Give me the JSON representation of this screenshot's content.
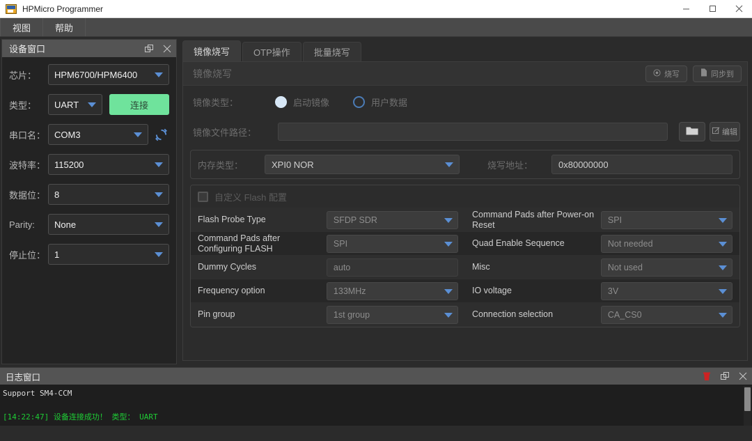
{
  "window": {
    "title": "HPMicro Programmer",
    "icon": "app-icon",
    "minimize": "–",
    "maximize": "□",
    "close": "×"
  },
  "menubar": {
    "items": [
      {
        "label": "视图"
      },
      {
        "label": "帮助"
      }
    ]
  },
  "device_panel": {
    "title": "设备窗口",
    "float_icon": "float-icon",
    "close_icon": "close-icon",
    "fields": {
      "chip_label": "芯片：",
      "chip_value": "HPM6700/HPM6400",
      "type_label": "类型：",
      "type_value": "UART",
      "connect_button": "连接",
      "port_label": "串口名：",
      "port_value": "COM3",
      "refresh_icon": "refresh-icon",
      "baud_label": "波特率：",
      "baud_value": "115200",
      "databits_label": "数据位：",
      "databits_value": "8",
      "parity_label": "Parity:",
      "parity_value": "None",
      "stopbits_label": "停止位：",
      "stopbits_value": "1"
    }
  },
  "main": {
    "tabs": [
      {
        "label": "镜像烧写",
        "active": true
      },
      {
        "label": "OTP操作",
        "active": false
      },
      {
        "label": "批量烧写",
        "active": false
      }
    ],
    "section_title": "镜像烧写",
    "actions": [
      {
        "label": "烧写",
        "icon": "burn-icon"
      },
      {
        "label": "同步到",
        "icon": "sync-icon"
      }
    ],
    "image_type": {
      "label": "镜像类型：",
      "options": [
        {
          "label": "启动镜像",
          "checked": true
        },
        {
          "label": "用户数据",
          "checked": false
        }
      ]
    },
    "file_path": {
      "label": "镜像文件路径：",
      "value": "",
      "placeholder": "",
      "browse_icon": "folder-icon",
      "edit_label": "编辑",
      "edit_icon": "edit-icon"
    },
    "memory": {
      "type_label": "内存类型：",
      "type_value": "XPI0 NOR",
      "addr_label": "烧写地址：",
      "addr_value": "0x80000000"
    },
    "flash_config": {
      "checkbox_label": "自定义 Flash 配置",
      "checked": false,
      "rows": [
        {
          "left_label": "Flash Probe Type",
          "left_value": "SFDP SDR",
          "left_type": "select",
          "right_label": "Command Pads after Power-on Reset",
          "right_value": "SPI",
          "right_type": "select"
        },
        {
          "left_label": "Command Pads after Configuring FLASH",
          "left_value": "SPI",
          "left_type": "select",
          "right_label": "Quad Enable Sequence",
          "right_value": "Not needed",
          "right_type": "select"
        },
        {
          "left_label": "Dummy Cycles",
          "left_value": "auto",
          "left_type": "input",
          "right_label": "Misc",
          "right_value": "Not used",
          "right_type": "select"
        },
        {
          "left_label": "Frequency option",
          "left_value": "133MHz",
          "left_type": "select",
          "right_label": "IO voltage",
          "right_value": "3V",
          "right_type": "select"
        },
        {
          "left_label": "Pin group",
          "left_value": "1st group",
          "left_type": "select",
          "right_label": "Connection selection",
          "right_value": "CA_CS0",
          "right_type": "select"
        }
      ]
    }
  },
  "log_window": {
    "title": "日志窗口",
    "clear_icon": "trash-icon",
    "float_icon": "float-icon",
    "close_icon": "close-icon",
    "lines": [
      {
        "text": "Support SM4-CCM",
        "color": "white"
      },
      {
        "text": "",
        "color": "white"
      },
      {
        "text": "[14:22:47] 设备连接成功！ 类型： UART",
        "color": "green"
      }
    ]
  },
  "colors": {
    "accent_green": "#6fe39c",
    "accent_blue": "#5b8fd4",
    "log_green": "#1ecc35",
    "clear_red": "#cc2222"
  }
}
